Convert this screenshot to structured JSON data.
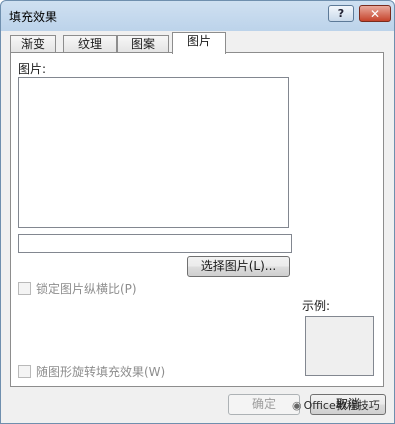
{
  "window": {
    "title": "填充效果",
    "help_label": "?",
    "close_label": "✕"
  },
  "tabs": [
    {
      "label": "渐变",
      "active": false
    },
    {
      "label": "纹理",
      "active": false
    },
    {
      "label": "图案",
      "active": false
    },
    {
      "label": "图片",
      "active": true
    }
  ],
  "picture": {
    "section_label": "图片:",
    "path_value": "",
    "select_button_label": "选择图片(L)..."
  },
  "options": {
    "lock_aspect_label": "锁定图片纵横比(P)",
    "lock_aspect_checked": false,
    "rotate_with_shape_label": "随图形旋转填充效果(W)",
    "rotate_with_shape_checked": false
  },
  "sample": {
    "label": "示例:"
  },
  "footer": {
    "ok_label": "确定",
    "cancel_label": "取消"
  },
  "watermark": {
    "text": "Office教程技巧"
  }
}
